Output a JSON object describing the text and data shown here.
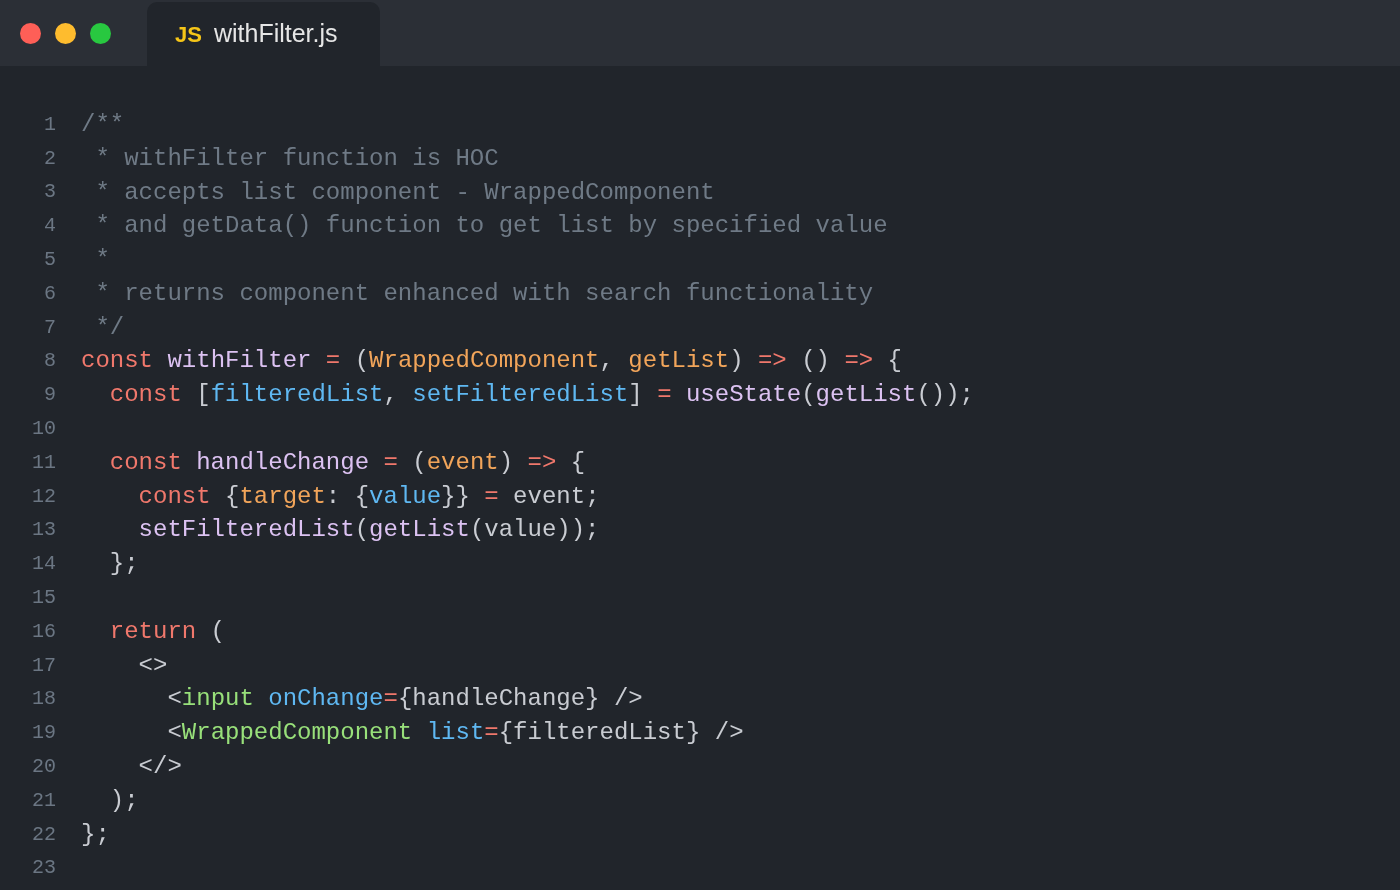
{
  "window": {
    "controls": [
      {
        "color": "#fe5f57"
      },
      {
        "color": "#febc2e"
      },
      {
        "color": "#28c840"
      }
    ]
  },
  "tabs": [
    {
      "badge": "JS",
      "label": "withFilter.js",
      "selected": true
    }
  ],
  "editor": {
    "lines": [
      {
        "number": "1",
        "tokens": [
          {
            "t": "/**",
            "kind": "comment"
          }
        ]
      },
      {
        "number": "2",
        "tokens": [
          {
            "t": " * withFilter function is HOC",
            "kind": "comment"
          }
        ]
      },
      {
        "number": "3",
        "tokens": [
          {
            "t": " * accepts list component - WrappedComponent",
            "kind": "comment"
          }
        ]
      },
      {
        "number": "4",
        "tokens": [
          {
            "t": " * and getData() function to get list by specified value",
            "kind": "comment"
          }
        ]
      },
      {
        "number": "5",
        "tokens": [
          {
            "t": " *",
            "kind": "comment"
          }
        ]
      },
      {
        "number": "6",
        "tokens": [
          {
            "t": " * returns component enhanced with search functionality",
            "kind": "comment"
          }
        ]
      },
      {
        "number": "7",
        "tokens": [
          {
            "t": " */",
            "kind": "comment"
          }
        ]
      },
      {
        "number": "8",
        "tokens": [
          {
            "t": "const ",
            "kind": "keyword"
          },
          {
            "t": "withFilter ",
            "kind": "function"
          },
          {
            "t": "=",
            "kind": "operator"
          },
          {
            "t": " (",
            "kind": "punct"
          },
          {
            "t": "WrappedComponent",
            "kind": "param"
          },
          {
            "t": ", ",
            "kind": "punct"
          },
          {
            "t": "getList",
            "kind": "param"
          },
          {
            "t": ") ",
            "kind": "punct"
          },
          {
            "t": "=>",
            "kind": "operator"
          },
          {
            "t": " () ",
            "kind": "punct"
          },
          {
            "t": "=>",
            "kind": "operator"
          },
          {
            "t": " {",
            "kind": "punct"
          }
        ]
      },
      {
        "number": "9",
        "tokens": [
          {
            "t": "  const",
            "kind": "keyword"
          },
          {
            "t": " [",
            "kind": "punct"
          },
          {
            "t": "filteredList",
            "kind": "variable"
          },
          {
            "t": ", ",
            "kind": "punct"
          },
          {
            "t": "setFilteredList",
            "kind": "variable"
          },
          {
            "t": "] ",
            "kind": "punct"
          },
          {
            "t": "= ",
            "kind": "operator"
          },
          {
            "t": "useState",
            "kind": "function"
          },
          {
            "t": "(",
            "kind": "punct"
          },
          {
            "t": "getList",
            "kind": "function"
          },
          {
            "t": "());",
            "kind": "punct"
          }
        ]
      },
      {
        "number": "10"
      },
      {
        "number": "11",
        "tokens": [
          {
            "t": "  const ",
            "kind": "keyword"
          },
          {
            "t": "handleChange ",
            "kind": "function"
          },
          {
            "t": "=",
            "kind": "operator"
          },
          {
            "t": " (",
            "kind": "punct"
          },
          {
            "t": "event",
            "kind": "param"
          },
          {
            "t": ") ",
            "kind": "punct"
          },
          {
            "t": "=>",
            "kind": "operator"
          },
          {
            "t": " {",
            "kind": "punct"
          }
        ]
      },
      {
        "number": "12",
        "tokens": [
          {
            "t": "    const",
            "kind": "keyword"
          },
          {
            "t": " {",
            "kind": "punct"
          },
          {
            "t": "target",
            "kind": "param"
          },
          {
            "t": ": {",
            "kind": "punct"
          },
          {
            "t": "value",
            "kind": "variable"
          },
          {
            "t": "}} ",
            "kind": "punct"
          },
          {
            "t": "=",
            "kind": "operator"
          },
          {
            "t": " event;",
            "kind": "punct"
          }
        ]
      },
      {
        "number": "13",
        "tokens": [
          {
            "t": "    setFilteredList",
            "kind": "function"
          },
          {
            "t": "(",
            "kind": "punct"
          },
          {
            "t": "getList",
            "kind": "function"
          },
          {
            "t": "(value));",
            "kind": "punct"
          }
        ]
      },
      {
        "number": "14",
        "tokens": [
          {
            "t": "  };",
            "kind": "punct"
          }
        ]
      },
      {
        "number": "15"
      },
      {
        "number": "16",
        "tokens": [
          {
            "t": "  return",
            "kind": "keyword"
          },
          {
            "t": " (",
            "kind": "punct"
          }
        ]
      },
      {
        "number": "17",
        "tokens": [
          {
            "t": "    <>",
            "kind": "punct"
          }
        ]
      },
      {
        "number": "18",
        "tokens": [
          {
            "t": "      <",
            "kind": "punct"
          },
          {
            "t": "input ",
            "kind": "tag"
          },
          {
            "t": "onChange",
            "kind": "attr"
          },
          {
            "t": "=",
            "kind": "operator"
          },
          {
            "t": "{handleChange} />",
            "kind": "punct"
          }
        ]
      },
      {
        "number": "19",
        "tokens": [
          {
            "t": "      <",
            "kind": "punct"
          },
          {
            "t": "WrappedComponent ",
            "kind": "tag"
          },
          {
            "t": "list",
            "kind": "attr"
          },
          {
            "t": "=",
            "kind": "operator"
          },
          {
            "t": "{filteredList} />",
            "kind": "punct"
          }
        ]
      },
      {
        "number": "20",
        "tokens": [
          {
            "t": "    </>",
            "kind": "punct"
          }
        ]
      },
      {
        "number": "21",
        "tokens": [
          {
            "t": "  );",
            "kind": "punct"
          }
        ]
      },
      {
        "number": "22",
        "tokens": [
          {
            "t": "};",
            "kind": "punct"
          }
        ]
      },
      {
        "number": "23"
      }
    ]
  }
}
